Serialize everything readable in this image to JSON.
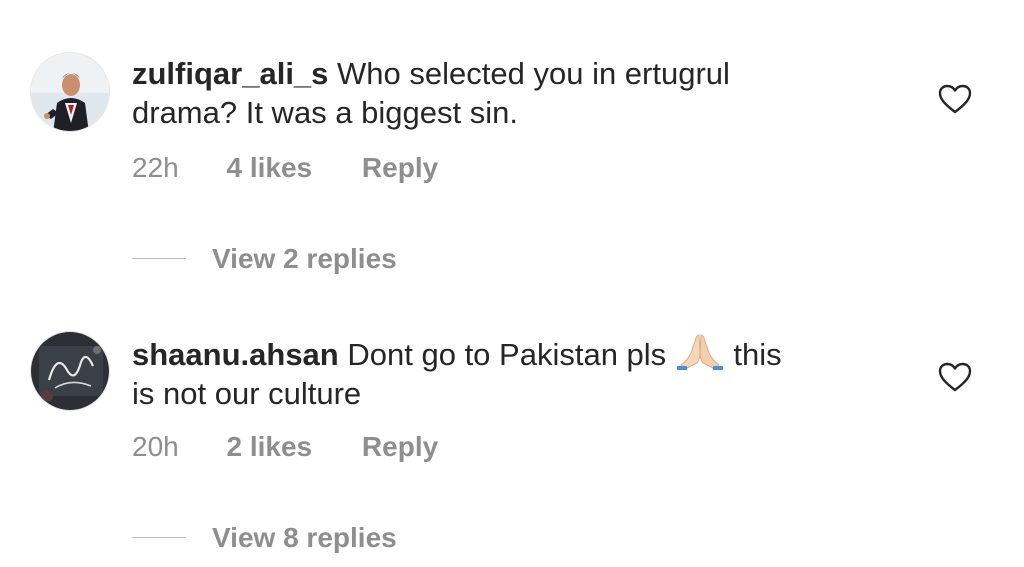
{
  "comments": [
    {
      "username": "zulfiqar_ali_s",
      "text_line1": "Who selected you in ertugrul",
      "text_line2": "drama? It was a biggest sin.",
      "time": "22h",
      "likes": "4 likes",
      "reply": "Reply",
      "view_replies": "View 2 replies",
      "avatar_icon": "profile-photo-man-in-suit"
    },
    {
      "username": "shaanu.ahsan",
      "text_line1_before_emoji": "Dont go to Pakistan pls",
      "emoji": "folded-hands-emoji",
      "text_line1_after_emoji": "this",
      "text_line2": "is not our culture",
      "time": "20h",
      "likes": "2 likes",
      "reply": "Reply",
      "view_replies": "View 8 replies",
      "avatar_icon": "profile-photo-calligraphy"
    }
  ],
  "icons": {
    "like": "heart-outline-icon"
  },
  "colors": {
    "primary_text": "#262626",
    "secondary_text": "#8e8e8e",
    "background": "#ffffff"
  }
}
